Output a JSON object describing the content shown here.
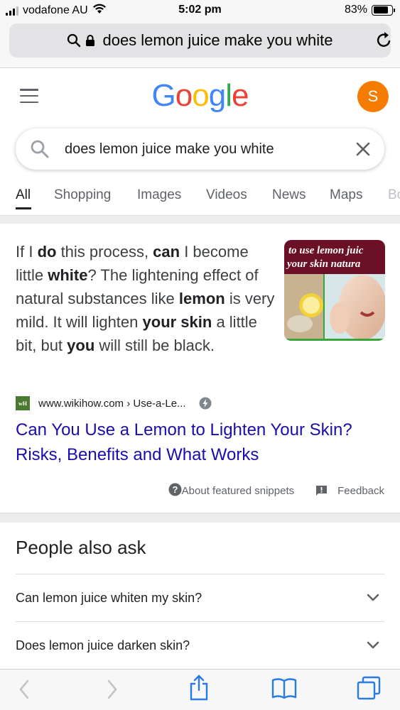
{
  "status_bar": {
    "carrier": "vodafone AU",
    "time": "5:02 pm",
    "battery_percent": "83%",
    "battery_level": 0.83
  },
  "browser": {
    "url_text": "does lemon juice make you white"
  },
  "google": {
    "avatar_initial": "S",
    "search_query": "does lemon juice make you white"
  },
  "tabs": [
    {
      "label": "All",
      "active": true
    },
    {
      "label": "Shopping",
      "active": false
    },
    {
      "label": "Images",
      "active": false
    },
    {
      "label": "Videos",
      "active": false
    },
    {
      "label": "News",
      "active": false
    },
    {
      "label": "Maps",
      "active": false
    },
    {
      "label": "Bo",
      "active": false
    }
  ],
  "snippet": {
    "text_segments": [
      {
        "t": "If I ",
        "bold": false
      },
      {
        "t": "do",
        "bold": true
      },
      {
        "t": " this process, ",
        "bold": false
      },
      {
        "t": "can",
        "bold": true
      },
      {
        "t": " I become little ",
        "bold": false
      },
      {
        "t": "white",
        "bold": true
      },
      {
        "t": "? The lightening effect of natural substances like ",
        "bold": false
      },
      {
        "t": "lemon",
        "bold": true
      },
      {
        "t": " is very mild. It will lighten ",
        "bold": false
      },
      {
        "t": "your skin",
        "bold": true
      },
      {
        "t": " a little bit, but ",
        "bold": false
      },
      {
        "t": "you",
        "bold": true
      },
      {
        "t": " will still be black.",
        "bold": false
      }
    ],
    "image_caption_line1": "to use lemon juic",
    "image_caption_line2": "your skin natura",
    "favicon_text": "wH",
    "source": "www.wikihow.com › Use-a-Le...",
    "title": "Can You Use a Lemon to Lighten Your Skin? Risks, Benefits and What Works",
    "about_label": "About featured snippets",
    "feedback_label": "Feedback"
  },
  "people_also_ask": {
    "title": "People also ask",
    "questions": [
      "Can lemon juice whiten my skin?",
      "Does lemon juice darken skin?"
    ]
  },
  "colors": {
    "google_blue": "#4285f4",
    "google_red": "#ea4335",
    "google_yellow": "#fbbc05",
    "google_green": "#34a853",
    "link": "#1a0dab",
    "avatar": "#f57c00",
    "safari_blue": "#2a7ae2"
  }
}
